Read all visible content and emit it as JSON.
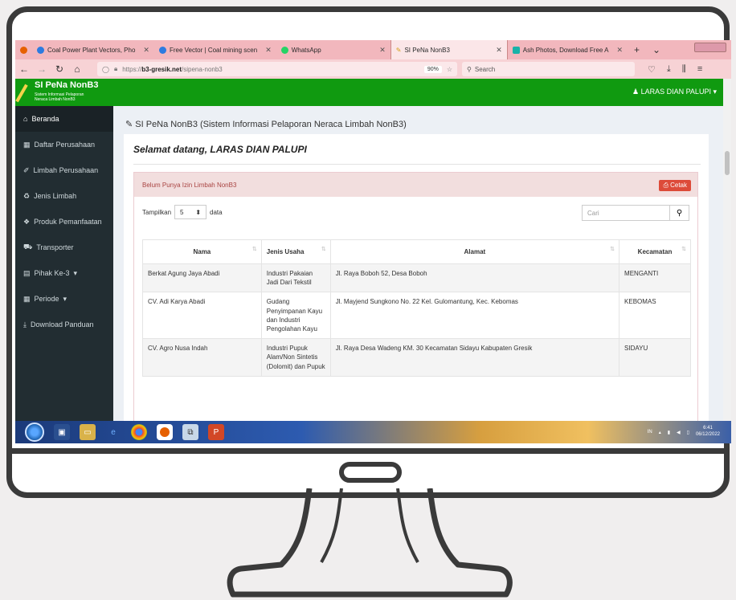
{
  "browser": {
    "tabs": [
      {
        "label": "Coal Power Plant Vectors, Pho",
        "active": false
      },
      {
        "label": "Free Vector | Coal mining scen",
        "active": false
      },
      {
        "label": "WhatsApp",
        "active": false
      },
      {
        "label": "SI PeNa NonB3",
        "active": true
      },
      {
        "label": "Ash Photos, Download Free A",
        "active": false
      }
    ],
    "url_prefix": "https://",
    "url_domain": "b3-gresik.net",
    "url_path": "/sipena-nonb3",
    "zoom": "90%",
    "search_placeholder": "Search"
  },
  "app": {
    "logo_name": "SI PeNa NonB3",
    "logo_sub1": "Sistem Informasi Pelaporan",
    "logo_sub2": "Neraca Limbah NonB3",
    "user": "LARAS DIAN PALUPI"
  },
  "sidebar": {
    "items": [
      {
        "label": "Beranda",
        "icon": "home-icon"
      },
      {
        "label": "Daftar Perusahaan",
        "icon": "building-icon"
      },
      {
        "label": "Limbah Perusahaan",
        "icon": "flask-icon"
      },
      {
        "label": "Jenis Limbah",
        "icon": "recycle-icon"
      },
      {
        "label": "Produk Pemanfaatan",
        "icon": "cube-icon"
      },
      {
        "label": "Transporter",
        "icon": "truck-icon"
      },
      {
        "label": "Pihak Ke-3",
        "icon": "id-card-icon"
      },
      {
        "label": "Periode",
        "icon": "calendar-icon"
      },
      {
        "label": "Download Panduan",
        "icon": "download-icon"
      }
    ]
  },
  "main": {
    "page_title": "SI PeNa NonB3 (Sistem Informasi Pelaporan Neraca Limbah NonB3)",
    "welcome": "Selamat datang, LARAS DIAN PALUPI",
    "panel_title": "Belum Punya Izin Limbah NonB3",
    "print_label": "Cetak",
    "show_label": "Tampilkan",
    "show_value": "5",
    "show_suffix": "data",
    "search_placeholder": "Cari",
    "table": {
      "headers": [
        "Nama",
        "Jenis Usaha",
        "Alamat",
        "Kecamatan"
      ],
      "rows": [
        [
          "Berkat Agung Jaya Abadi",
          "Industri Pakaian Jadi Dari Tekstil",
          "Jl. Raya Boboh 52, Desa Boboh",
          "MENGANTI"
        ],
        [
          "CV. Adi Karya Abadi",
          "Gudang Penyimpanan Kayu dan Industri Pengolahan Kayu",
          "Jl. Mayjend Sungkono No. 22 Kel. Gulomantung, Kec. Kebomas",
          "KEBOMAS"
        ],
        [
          "CV. Agro Nusa Indah",
          "Industri Pupuk Alam/Non Sintetis (Dolomit) dan Pupuk",
          "Jl. Raya Desa Wadeng KM. 30 Kecamatan Sidayu Kabupaten Gresik",
          "SIDAYU"
        ]
      ]
    }
  },
  "taskbar": {
    "lang": "IN",
    "time": "6:41",
    "date": "06/12/2022"
  }
}
